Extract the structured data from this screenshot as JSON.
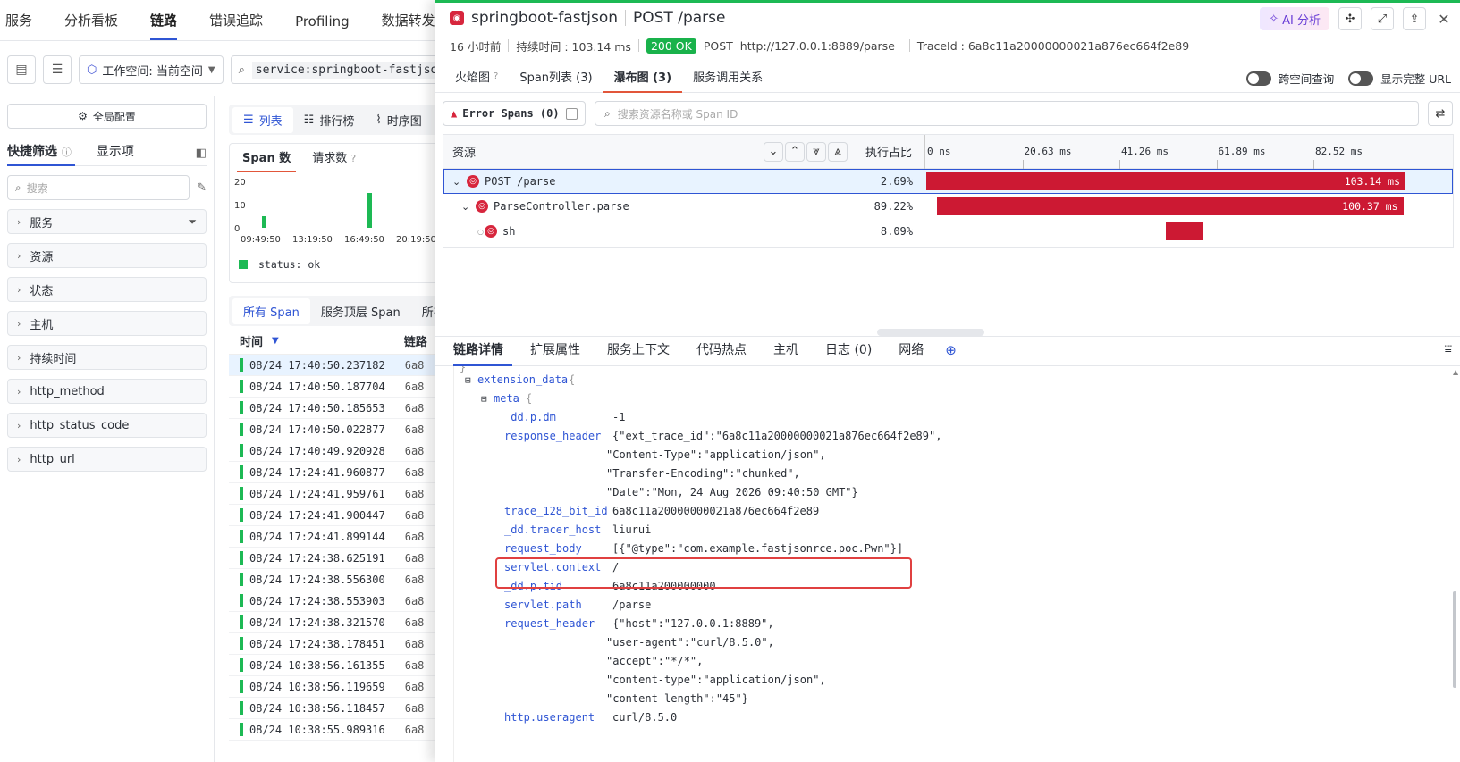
{
  "nav": {
    "tabs": [
      "服务",
      "分析看板",
      "链路",
      "错误追踪",
      "Profiling",
      "数据转发"
    ],
    "active": "链路"
  },
  "toolbar": {
    "workspace": "工作空间: 当前空间",
    "query": "service:springboot-fastjson"
  },
  "sidebar": {
    "global_config": "全局配置",
    "tabs": [
      "快捷筛选",
      "显示项"
    ],
    "search_placeholder": "搜索",
    "facets": [
      "服务",
      "资源",
      "状态",
      "主机",
      "持续时间",
      "http_method",
      "http_status_code",
      "http_url"
    ]
  },
  "mid": {
    "view_tabs": [
      "列表",
      "排行榜",
      "时序图"
    ],
    "chart_tabs": [
      "Span 数",
      "请求数"
    ],
    "legend": "status: ok",
    "span_tabs": [
      "所有 Span",
      "服务顶层 Span",
      "所有"
    ],
    "col_time": "时间",
    "col_trace": "链路",
    "rows": [
      "08/24 17:40:50.237182",
      "08/24 17:40:50.187704",
      "08/24 17:40:50.185653",
      "08/24 17:40:50.022877",
      "08/24 17:40:49.920928",
      "08/24 17:24:41.960877",
      "08/24 17:24:41.959761",
      "08/24 17:24:41.900447",
      "08/24 17:24:41.899144",
      "08/24 17:24:38.625191",
      "08/24 17:24:38.556300",
      "08/24 17:24:38.553903",
      "08/24 17:24:38.321570",
      "08/24 17:24:38.178451",
      "08/24 10:38:56.161355",
      "08/24 10:38:56.119659",
      "08/24 10:38:56.118457",
      "08/24 10:38:55.989316"
    ],
    "trace_prefix": "6a8"
  },
  "chart_data": {
    "type": "bar",
    "title": "Span 数",
    "x_ticks": [
      "09:49:50",
      "13:19:50",
      "16:49:50",
      "20:19:50"
    ],
    "y_ticks": [
      "20",
      "10",
      "0"
    ],
    "ylim": [
      0,
      20
    ],
    "series": [
      {
        "name": "status: ok",
        "color": "#1db954",
        "values": [
          {
            "x": "09:49:50",
            "y": 5
          },
          {
            "x": "16:49:50",
            "y": 15
          }
        ]
      }
    ]
  },
  "drawer": {
    "service": "springboot-fastjson",
    "operation": "POST /parse",
    "ai_label": "AI 分析",
    "time_ago": "16 小时前",
    "duration": "持续时间 : 103.14 ms",
    "status": "200 OK",
    "method": "POST",
    "url": "http://127.0.0.1:8889/parse",
    "trace_id": "TraceId : 6a8c11a20000000021a876ec664f2e89",
    "tabs": [
      "火焰图",
      "Span列表 (3)",
      "瀑布图 (3)",
      "服务调用关系"
    ],
    "active_tab": "瀑布图 (3)",
    "toggle1": "跨空间查询",
    "toggle2": "显示完整 URL",
    "error_spans": "Error Spans (0)",
    "search_placeholder": "搜索资源名称或 Span ID",
    "wf_col_resource": "资源",
    "wf_col_pct": "执行占比",
    "wf_ticks": [
      "0 ns",
      "20.63 ms",
      "41.26 ms",
      "61.89 ms",
      "82.52 ms"
    ],
    "spans": [
      {
        "name": "POST /parse",
        "pct": "2.69%",
        "dur": "103.14 ms",
        "start_ms": 0,
        "length_ms": 103.14
      },
      {
        "name": "ParseController.parse",
        "pct": "89.22%",
        "dur": "100.37 ms",
        "start_ms": 2.3,
        "length_ms": 100.37
      },
      {
        "name": "sh",
        "pct": "8.09%",
        "dur": "",
        "start_ms": 51.5,
        "length_ms": 8.1
      }
    ],
    "detail_tabs": [
      "链路详情",
      "扩展属性",
      "服务上下文",
      "代码热点",
      "主机",
      "日志 (0)",
      "网络"
    ],
    "detail": {
      "brace_close": "}",
      "ext_key": "extension_data",
      "ext_open": "{",
      "meta_key": "meta",
      "meta_open": "{",
      "lines": [
        {
          "k": "_dd.p.dm",
          "v": "-1"
        },
        {
          "k": "response_header",
          "v": "{\"ext_trace_id\":\"6a8c11a20000000021a876ec664f2e89\","
        },
        {
          "k": "",
          "v": "\"Content-Type\":\"application/json\","
        },
        {
          "k": "",
          "v": "\"Transfer-Encoding\":\"chunked\","
        },
        {
          "k": "",
          "v": "\"Date\":\"Mon, 24 Aug 2026 09:40:50 GMT\"}"
        },
        {
          "k": "trace_128_bit_id",
          "v": "6a8c11a20000000021a876ec664f2e89"
        },
        {
          "k": "_dd.tracer_host",
          "v": "liurui"
        },
        {
          "k": "request_body",
          "v": "[{\"@type\":\"com.example.fastjsonrce.poc.Pwn\"}]"
        },
        {
          "k": "servlet.context",
          "v": "/"
        },
        {
          "k": "_dd.p.tid",
          "v": "6a8c11a200000000"
        },
        {
          "k": "servlet.path",
          "v": "/parse"
        },
        {
          "k": "request_header",
          "v": "{\"host\":\"127.0.0.1:8889\","
        },
        {
          "k": "",
          "v": "\"user-agent\":\"curl/8.5.0\","
        },
        {
          "k": "",
          "v": "\"accept\":\"*/*\","
        },
        {
          "k": "",
          "v": "\"content-type\":\"application/json\","
        },
        {
          "k": "",
          "v": "\"content-length\":\"45\"}"
        },
        {
          "k": "http.useragent",
          "v": "curl/8.5.0"
        }
      ]
    }
  }
}
